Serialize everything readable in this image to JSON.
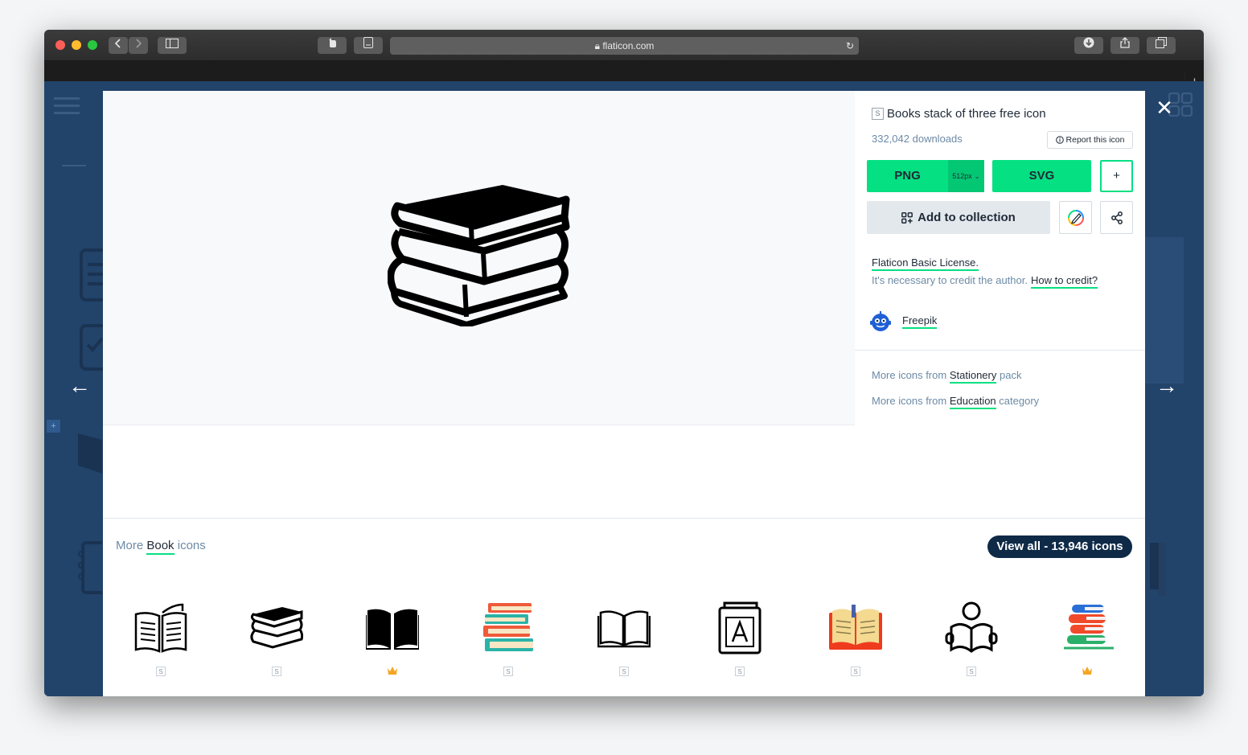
{
  "browser": {
    "url": "flaticon.com",
    "new_tab_symbol": "+"
  },
  "modal": {
    "icon_title": "Books stack of three free icon",
    "badge": "S",
    "downloads": "332,042 downloads",
    "report_label": "Report this icon",
    "png_label": "PNG",
    "png_size": "512px",
    "svg_label": "SVG",
    "plus_label": "+",
    "add_collection_label": "Add to collection",
    "license_label": "Flaticon Basic License.",
    "credit_note": "It's necessary to credit the author.",
    "credit_link": "How to credit?",
    "author": "Freepik",
    "more_pack_prefix": "More icons from",
    "more_pack_link": "Stationery",
    "more_pack_suffix": "pack",
    "more_cat_prefix": "More icons from",
    "more_cat_link": "Education",
    "more_cat_suffix": "category",
    "close_symbol": "✕",
    "prev_symbol": "←",
    "next_symbol": "→"
  },
  "more_icons": {
    "prefix": "More",
    "keyword": "Book",
    "suffix": "icons",
    "view_all_label": "View all - 13,946 icons",
    "thumbs": [
      {
        "name": "open-book-lines-icon",
        "tier": "S"
      },
      {
        "name": "books-stack-icon",
        "tier": "S"
      },
      {
        "name": "open-book-solid-icon",
        "tier": "premium"
      },
      {
        "name": "books-stack-color-icon",
        "tier": "S"
      },
      {
        "name": "open-book-outline-icon",
        "tier": "S"
      },
      {
        "name": "book-letter-a-icon",
        "tier": "S"
      },
      {
        "name": "open-book-color-icon",
        "tier": "S"
      },
      {
        "name": "reader-icon",
        "tier": "S"
      },
      {
        "name": "books-stack-flat-icon",
        "tier": "premium"
      }
    ]
  },
  "colors": {
    "accent_green": "#05e082",
    "navy": "#0e2a47",
    "crown": "#f5a623"
  }
}
